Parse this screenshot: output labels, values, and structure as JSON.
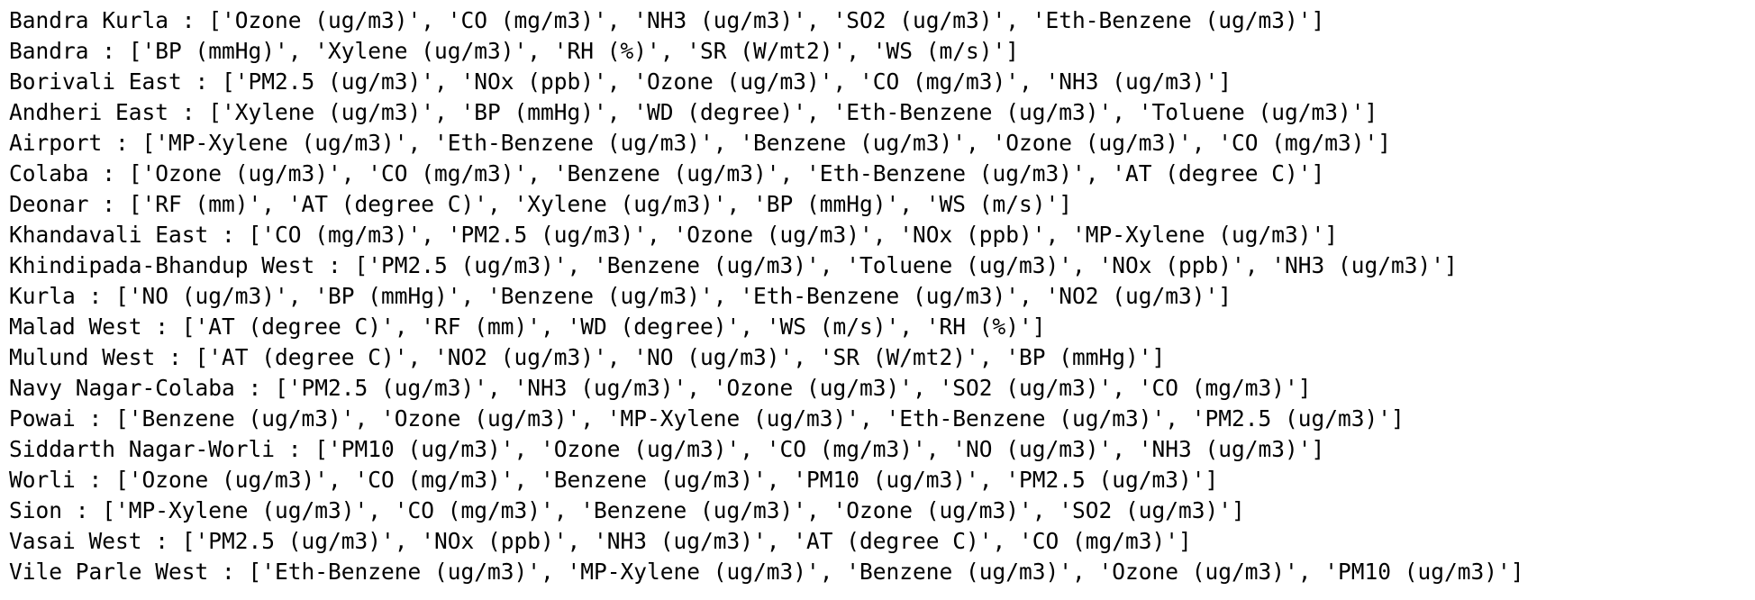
{
  "lines": [
    "Bandra Kurla : ['Ozone (ug/m3)', 'CO (mg/m3)', 'NH3 (ug/m3)', 'SO2 (ug/m3)', 'Eth-Benzene (ug/m3)']",
    "Bandra : ['BP (mmHg)', 'Xylene (ug/m3)', 'RH (%)', 'SR (W/mt2)', 'WS (m/s)']",
    "Borivali East : ['PM2.5 (ug/m3)', 'NOx (ppb)', 'Ozone (ug/m3)', 'CO (mg/m3)', 'NH3 (ug/m3)']",
    "Andheri East : ['Xylene (ug/m3)', 'BP (mmHg)', 'WD (degree)', 'Eth-Benzene (ug/m3)', 'Toluene (ug/m3)']",
    "Airport : ['MP-Xylene (ug/m3)', 'Eth-Benzene (ug/m3)', 'Benzene (ug/m3)', 'Ozone (ug/m3)', 'CO (mg/m3)']",
    "Colaba : ['Ozone (ug/m3)', 'CO (mg/m3)', 'Benzene (ug/m3)', 'Eth-Benzene (ug/m3)', 'AT (degree C)']",
    "Deonar : ['RF (mm)', 'AT (degree C)', 'Xylene (ug/m3)', 'BP (mmHg)', 'WS (m/s)']",
    "Khandavali East : ['CO (mg/m3)', 'PM2.5 (ug/m3)', 'Ozone (ug/m3)', 'NOx (ppb)', 'MP-Xylene (ug/m3)']",
    "Khindipada-Bhandup West : ['PM2.5 (ug/m3)', 'Benzene (ug/m3)', 'Toluene (ug/m3)', 'NOx (ppb)', 'NH3 (ug/m3)']",
    "Kurla : ['NO (ug/m3)', 'BP (mmHg)', 'Benzene (ug/m3)', 'Eth-Benzene (ug/m3)', 'NO2 (ug/m3)']",
    "Malad West : ['AT (degree C)', 'RF (mm)', 'WD (degree)', 'WS (m/s)', 'RH (%)']",
    "Mulund West : ['AT (degree C)', 'NO2 (ug/m3)', 'NO (ug/m3)', 'SR (W/mt2)', 'BP (mmHg)']",
    "Navy Nagar-Colaba : ['PM2.5 (ug/m3)', 'NH3 (ug/m3)', 'Ozone (ug/m3)', 'SO2 (ug/m3)', 'CO (mg/m3)']",
    "Powai : ['Benzene (ug/m3)', 'Ozone (ug/m3)', 'MP-Xylene (ug/m3)', 'Eth-Benzene (ug/m3)', 'PM2.5 (ug/m3)']",
    "Siddarth Nagar-Worli : ['PM10 (ug/m3)', 'Ozone (ug/m3)', 'CO (mg/m3)', 'NO (ug/m3)', 'NH3 (ug/m3)']",
    "Worli : ['Ozone (ug/m3)', 'CO (mg/m3)', 'Benzene (ug/m3)', 'PM10 (ug/m3)', 'PM2.5 (ug/m3)']",
    "Sion : ['MP-Xylene (ug/m3)', 'CO (mg/m3)', 'Benzene (ug/m3)', 'Ozone (ug/m3)', 'SO2 (ug/m3)']",
    "Vasai West : ['PM2.5 (ug/m3)', 'NOx (ppb)', 'NH3 (ug/m3)', 'AT (degree C)', 'CO (mg/m3)']",
    "Vile Parle West : ['Eth-Benzene (ug/m3)', 'MP-Xylene (ug/m3)', 'Benzene (ug/m3)', 'Ozone (ug/m3)', 'PM10 (ug/m3)']"
  ]
}
